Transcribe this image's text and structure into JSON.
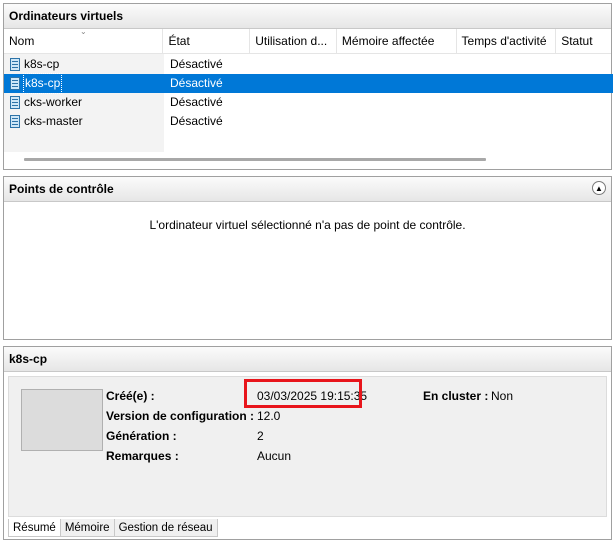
{
  "vm_list": {
    "title": "Ordinateurs virtuels",
    "columns": [
      "Nom",
      "État",
      "Utilisation d...",
      "Mémoire affectée",
      "Temps d'activité",
      "Statut"
    ],
    "rows": [
      {
        "name": "k8s-cp",
        "state": "Désactivé"
      },
      {
        "name": "k8s-cp",
        "state": "Désactivé"
      },
      {
        "name": "cks-worker",
        "state": "Désactivé"
      },
      {
        "name": "cks-master",
        "state": "Désactivé"
      }
    ]
  },
  "checkpoints": {
    "title": "Points de contrôle",
    "message": "L'ordinateur virtuel sélectionné n'a pas de point de contrôle."
  },
  "details": {
    "title": "k8s-cp",
    "created_label": "Créé(e) :",
    "created_value": "03/03/2025 19:15:35",
    "config_version_label": "Version de configuration :",
    "config_version_value": "12.0",
    "generation_label": "Génération :",
    "generation_value": "2",
    "notes_label": "Remarques :",
    "notes_value": "Aucun",
    "cluster_label": "En cluster :",
    "cluster_value": "Non",
    "tabs": [
      "Résumé",
      "Mémoire",
      "Gestion de réseau"
    ]
  },
  "colors": {
    "selection": "#0078d7",
    "highlight_box": "#e8151b"
  }
}
